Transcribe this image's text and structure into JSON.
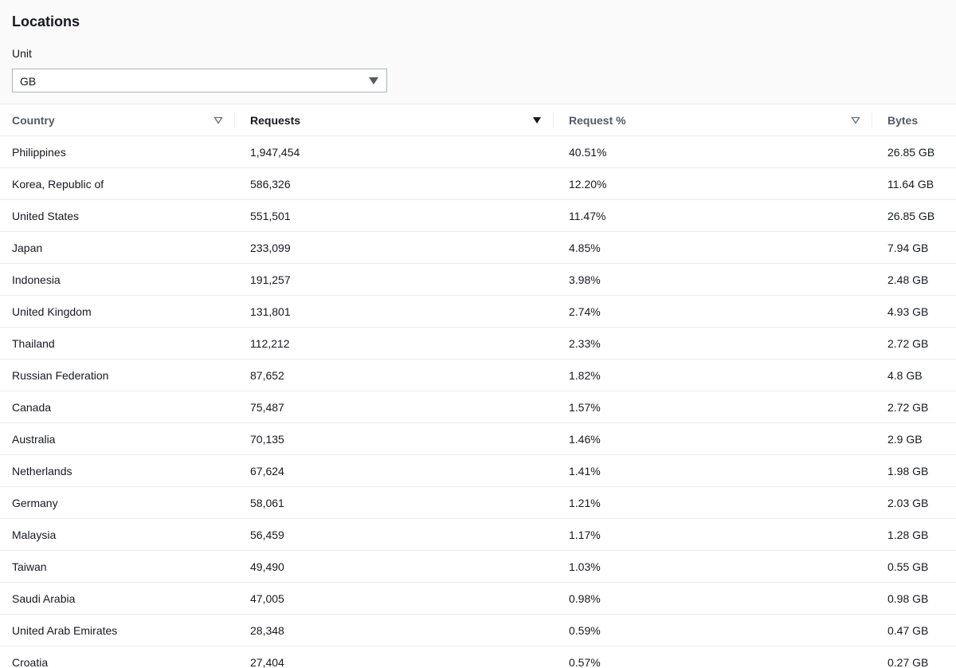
{
  "panel": {
    "title": "Locations",
    "unit_label": "Unit",
    "unit_value": "GB"
  },
  "table": {
    "columns": [
      {
        "label": "Country",
        "sort": "none"
      },
      {
        "label": "Requests",
        "sort": "descending"
      },
      {
        "label": "Request %",
        "sort": "none"
      },
      {
        "label": "Bytes",
        "sort": "none"
      }
    ],
    "rows": [
      [
        "Philippines",
        "1,947,454",
        "40.51%",
        "26.85 GB"
      ],
      [
        "Korea, Republic of",
        "586,326",
        "12.20%",
        "11.64 GB"
      ],
      [
        "United States",
        "551,501",
        "11.47%",
        "26.85 GB"
      ],
      [
        "Japan",
        "233,099",
        "4.85%",
        "7.94 GB"
      ],
      [
        "Indonesia",
        "191,257",
        "3.98%",
        "2.48 GB"
      ],
      [
        "United Kingdom",
        "131,801",
        "2.74%",
        "4.93 GB"
      ],
      [
        "Thailand",
        "112,212",
        "2.33%",
        "2.72 GB"
      ],
      [
        "Russian Federation",
        "87,652",
        "1.82%",
        "4.8 GB"
      ],
      [
        "Canada",
        "75,487",
        "1.57%",
        "2.72 GB"
      ],
      [
        "Australia",
        "70,135",
        "1.46%",
        "2.9 GB"
      ],
      [
        "Netherlands",
        "67,624",
        "1.41%",
        "1.98 GB"
      ],
      [
        "Germany",
        "58,061",
        "1.21%",
        "2.03 GB"
      ],
      [
        "Malaysia",
        "56,459",
        "1.17%",
        "1.28 GB"
      ],
      [
        "Taiwan",
        "49,490",
        "1.03%",
        "0.55 GB"
      ],
      [
        "Saudi Arabia",
        "47,005",
        "0.98%",
        "0.98 GB"
      ],
      [
        "United Arab Emirates",
        "28,348",
        "0.59%",
        "0.47 GB"
      ],
      [
        "Croatia",
        "27,404",
        "0.57%",
        "0.27 GB"
      ]
    ]
  },
  "icons": {
    "sort_inactive": "sort-inactive-triangle-icon",
    "sort_active": "sort-descending-icon",
    "select_caret": "caret-down-icon"
  }
}
